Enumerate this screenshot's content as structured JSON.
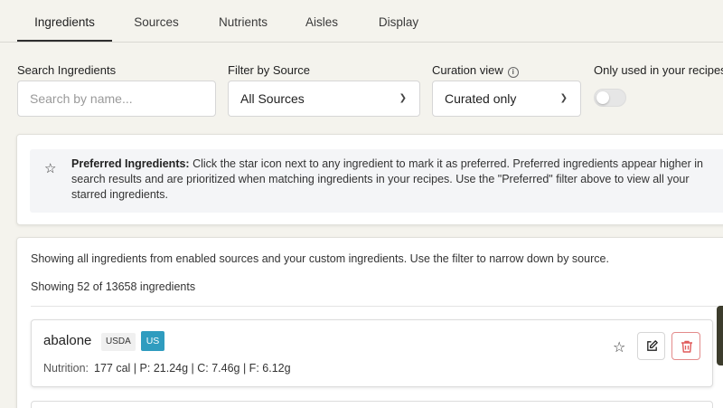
{
  "tabs": [
    {
      "label": "Ingredients",
      "active": true
    },
    {
      "label": "Sources"
    },
    {
      "label": "Nutrients"
    },
    {
      "label": "Aisles"
    },
    {
      "label": "Display"
    }
  ],
  "filters": {
    "search": {
      "label": "Search Ingredients",
      "placeholder": "Search by name..."
    },
    "source": {
      "label": "Filter by Source",
      "value": "All Sources"
    },
    "curation": {
      "label": "Curation view",
      "value": "Curated only",
      "info_icon": "info-circle-icon"
    },
    "only_used": {
      "label": "Only used in your recipes",
      "enabled": false
    }
  },
  "preferred_note": {
    "title": "Preferred Ingredients:",
    "text": "Click the star icon next to any ingredient to mark it as preferred. Preferred ingredients appear higher in search results and are prioritized when matching ingredients in your recipes. Use the \"Preferred\" filter above to view all your starred ingredients.",
    "icon": "star-outline-icon"
  },
  "list": {
    "description": "Showing all ingredients from enabled sources and your custom ingredients. Use the filter to narrow down by source.",
    "count": "Showing 52 of 13658 ingredients",
    "items": [
      {
        "name": "abalone",
        "source": "USDA",
        "region": "US",
        "nutrition_label": "Nutrition:",
        "nutrition": "177 cal | P: 21.24g | C: 7.46g | F: 6.12g"
      }
    ]
  },
  "colors": {
    "background": "#f4f3ed",
    "region_badge": "#2f9cbf",
    "delete_accent": "#e05a5a"
  }
}
